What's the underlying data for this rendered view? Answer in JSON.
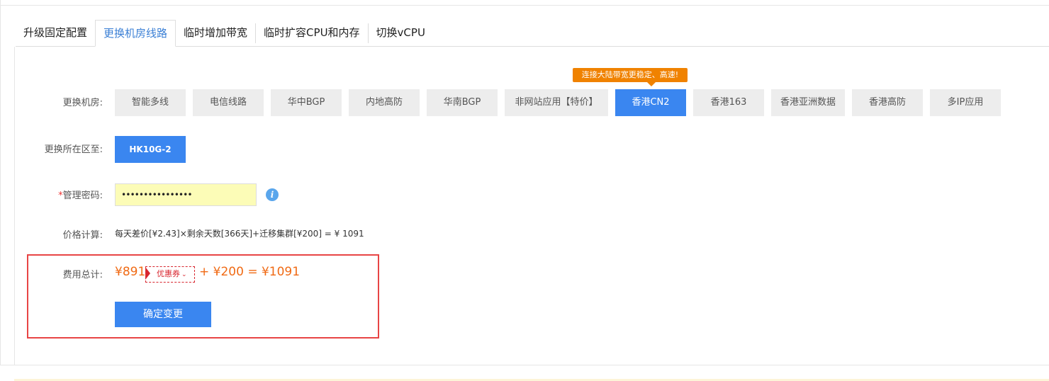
{
  "tabs": [
    {
      "label": "升级固定配置",
      "active": false
    },
    {
      "label": "更换机房线路",
      "active": true
    },
    {
      "label": "临时增加带宽",
      "active": false
    },
    {
      "label": "临时扩容CPU和内存",
      "active": false
    },
    {
      "label": "切换vCPU",
      "active": false
    }
  ],
  "form": {
    "room": {
      "label": "更换机房:",
      "tip": "连接大陆带宽更稳定、高速!",
      "options": [
        "智能多线",
        "电信线路",
        "华中BGP",
        "内地高防",
        "华南BGP",
        "非网站应用【特价】",
        "香港CN2",
        "香港163",
        "香港亚洲数据",
        "香港高防",
        "多IP应用"
      ],
      "selected": "香港CN2"
    },
    "zone": {
      "label": "更换所在区至:",
      "value": "HK10G-2"
    },
    "password": {
      "required_mark": "*",
      "label": "管理密码:",
      "value": "••••••••••••••••",
      "info_icon": "info-icon"
    },
    "calc": {
      "label": "价格计算:",
      "text": "每天差价[¥2.43]×剩余天数[366天]+迁移集群[¥200] = ¥ 1091"
    },
    "total": {
      "label": "费用总计:",
      "base_price": "¥891",
      "coupon_label": "优惠券",
      "rest": "+ ¥200 = ¥1091"
    },
    "confirm_label": "确定变更"
  },
  "colors": {
    "primary": "#3a86f0",
    "tab_active": "#3a7fd5",
    "price": "#f06a14",
    "tip_bg": "#f08200",
    "coupon": "#d8262f",
    "highlight_border": "#e84545",
    "password_bg": "#fcfcb7"
  }
}
